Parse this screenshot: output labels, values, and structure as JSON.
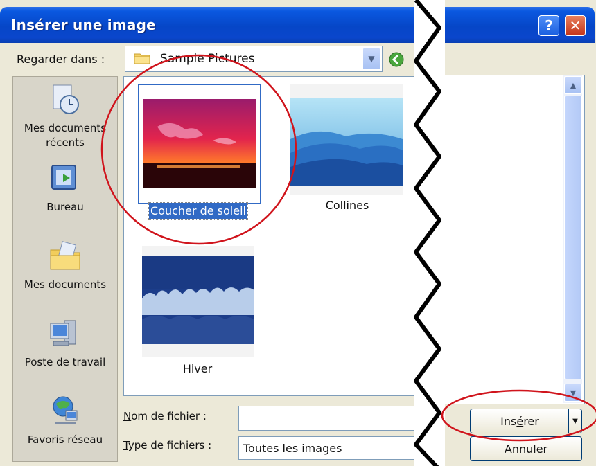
{
  "window": {
    "title": "Insérer une image",
    "help_glyph": "?",
    "close_glyph": "✕"
  },
  "lookin": {
    "label_prefix": "Regarder ",
    "label_underlined": "d",
    "label_suffix": "ans :",
    "folder": "Sample Pictures"
  },
  "places": [
    {
      "label_line1": "Mes documents",
      "label_line2": "récents",
      "icon": "recent-documents-icon"
    },
    {
      "label_line1": "Bureau",
      "label_line2": "",
      "icon": "desktop-icon"
    },
    {
      "label_line1": "Mes documents",
      "label_line2": "",
      "icon": "my-documents-icon"
    },
    {
      "label_line1": "Poste de travail",
      "label_line2": "",
      "icon": "my-computer-icon"
    },
    {
      "label_line1": "Favoris réseau",
      "label_line2": "",
      "icon": "network-places-icon"
    }
  ],
  "files": [
    {
      "name": "Coucher de soleil",
      "selected": true
    },
    {
      "name": "Collines",
      "selected": false
    },
    {
      "name": "Hiver",
      "selected": false
    }
  ],
  "filename": {
    "label_underlined": "N",
    "label_rest": "om de fichier :",
    "value": ""
  },
  "filetype": {
    "label_underlined": "T",
    "label_rest": "ype de fichiers :",
    "value": "Toutes les images"
  },
  "buttons": {
    "insert_pre": "Ins",
    "insert_underlined": "é",
    "insert_post": "rer",
    "cancel": "Annuler"
  },
  "colors": {
    "title_blue": "#0646c7",
    "annotation_red": "#d0141c",
    "selection_blue": "#316ac5"
  }
}
